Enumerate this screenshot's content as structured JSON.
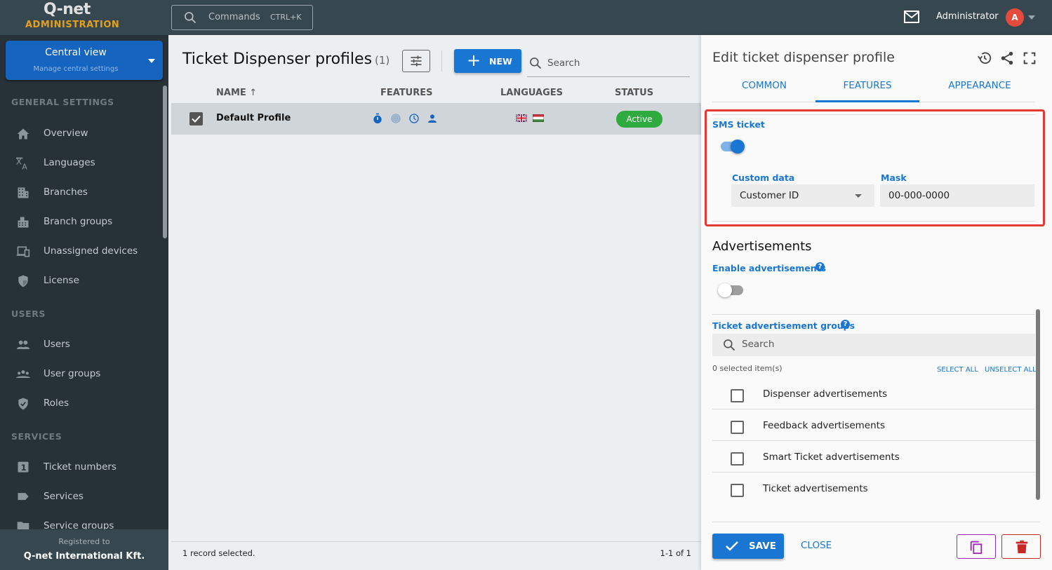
{
  "header": {
    "brand": "Q-net",
    "subtitle": "ADMINISTRATION",
    "commands_label": "Commands",
    "commands_shortcut": "CTRL+K",
    "user_name": "Administrator",
    "avatar_initial": "A"
  },
  "sidebar": {
    "context": {
      "title": "Central view",
      "subtitle": "Manage central settings"
    },
    "sections": [
      {
        "title": "GENERAL SETTINGS",
        "items": [
          {
            "label": "Overview",
            "icon": "home-icon"
          },
          {
            "label": "Languages",
            "icon": "translate-icon"
          },
          {
            "label": "Branches",
            "icon": "building-icon"
          },
          {
            "label": "Branch groups",
            "icon": "buildings-icon"
          },
          {
            "label": "Unassigned devices",
            "icon": "devices-icon"
          },
          {
            "label": "License",
            "icon": "shield-icon"
          }
        ]
      },
      {
        "title": "USERS",
        "items": [
          {
            "label": "Users",
            "icon": "users-icon"
          },
          {
            "label": "User groups",
            "icon": "user-groups-icon"
          },
          {
            "label": "Roles",
            "icon": "shield-check-icon"
          }
        ]
      },
      {
        "title": "SERVICES",
        "items": [
          {
            "label": "Ticket numbers",
            "icon": "number-one-icon"
          },
          {
            "label": "Services",
            "icon": "label-icon"
          },
          {
            "label": "Service groups",
            "icon": "folder-icon"
          }
        ]
      }
    ],
    "registered_label": "Registered to",
    "registered_to": "Q-net International Kft."
  },
  "list": {
    "title": "Ticket Dispenser profiles",
    "count": "(1)",
    "new_label": "NEW",
    "search_placeholder": "Search",
    "columns": [
      "NAME",
      "FEATURES",
      "LANGUAGES",
      "STATUS"
    ],
    "sort_indicator": "↑",
    "rows": [
      {
        "name": "Default Profile",
        "selected": true,
        "features": [
          "timer-icon",
          "fingerprint-icon",
          "clock-icon",
          "person-icon"
        ],
        "languages": [
          "en-gb",
          "hu"
        ],
        "status": "Active"
      }
    ],
    "footer_selected": "1 record selected.",
    "footer_range": "1-1 of 1"
  },
  "panel": {
    "title": "Edit ticket dispenser profile",
    "tabs": [
      "COMMON",
      "FEATURES",
      "APPEARANCE"
    ],
    "active_tab": "FEATURES",
    "sms": {
      "label": "SMS ticket",
      "enabled": true,
      "custom_data_label": "Custom data",
      "custom_data_value": "Customer ID",
      "mask_label": "Mask",
      "mask_value": "00-000-0000"
    },
    "ads": {
      "heading": "Advertisements",
      "enable_label": "Enable advertisements",
      "enabled": false,
      "groups_label": "Ticket advertisement groups",
      "search_placeholder": "Search",
      "selected_count": "0 selected item(s)",
      "select_all": "SELECT ALL",
      "unselect_all": "UNSELECT ALL",
      "items": [
        {
          "label": "Dispenser advertisements",
          "checked": false
        },
        {
          "label": "Feedback advertisements",
          "checked": false
        },
        {
          "label": "Smart Ticket advertisements",
          "checked": false
        },
        {
          "label": "Ticket advertisements",
          "checked": false
        }
      ]
    },
    "save_label": "SAVE",
    "close_label": "CLOSE"
  },
  "colors": {
    "accent": "#1976d2",
    "status_active": "#2eaa3f",
    "highlight_border": "#e53935",
    "copy": "#9c27b0",
    "delete": "#c62828"
  }
}
